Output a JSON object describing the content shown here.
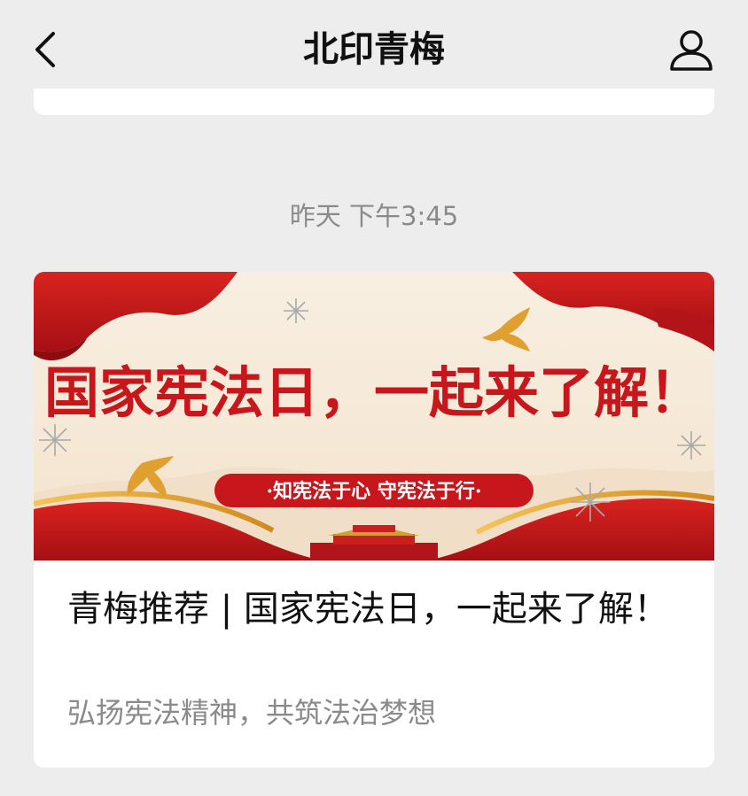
{
  "header": {
    "back_icon": "chevron-left-icon",
    "title": "北印青梅",
    "profile_icon": "person-icon"
  },
  "timestamp": "昨天 下午3:45",
  "article": {
    "banner": {
      "headline": "国家宪法日，一起来了解！",
      "slogan": "·知宪法于心 守宪法于行·"
    },
    "title": "青梅推荐 | 国家宪法日，一起来了解！",
    "description": "弘扬宪法精神，共筑法治梦想"
  },
  "colors": {
    "background": "#ededed",
    "card": "#ffffff",
    "banner_red": "#c8161d",
    "gold": "#e0a030",
    "muted_text": "#8a8a8a"
  }
}
